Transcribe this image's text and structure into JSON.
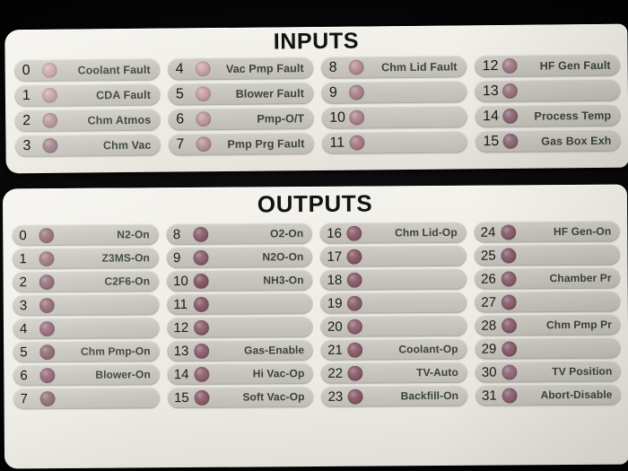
{
  "colors": {
    "background": "#000000",
    "panel": "#efeee8",
    "pill": "#c6c4bc",
    "label_text": "#3b4340",
    "number_text": "#1b1b1b",
    "title_text": "#141414",
    "led_inputs": "#c9a3a8",
    "led_outputs": "#8e5f6b"
  },
  "panels": [
    {
      "id": "inputs",
      "title": "INPUTS",
      "columns": [
        {
          "rows": [
            {
              "number": "0",
              "label": "Coolant Fault",
              "led": "#caa4a8"
            },
            {
              "number": "1",
              "label": "CDA Fault",
              "led": "#c49ca2"
            },
            {
              "number": "2",
              "label": "Chm Atmos",
              "led": "#b48f96"
            },
            {
              "number": "3",
              "label": "Chm Vac",
              "led": "#9c7c88"
            }
          ]
        },
        {
          "rows": [
            {
              "number": "4",
              "label": "Vac Pmp Fault",
              "led": "#cda5a7"
            },
            {
              "number": "5",
              "label": "Blower Fault",
              "led": "#c9a0a4"
            },
            {
              "number": "6",
              "label": "Pmp-O/T",
              "led": "#c09aa0"
            },
            {
              "number": "7",
              "label": "Pmp Prg Fault",
              "led": "#b8919a"
            }
          ]
        },
        {
          "rows": [
            {
              "number": "8",
              "label": "Chm Lid Fault",
              "led": "#b78f98"
            },
            {
              "number": "9",
              "label": "",
              "led": "#ab848f"
            },
            {
              "number": "10",
              "label": "",
              "led": "#b0848f"
            },
            {
              "number": "11",
              "label": "",
              "led": "#a87c89"
            }
          ]
        },
        {
          "rows": [
            {
              "number": "12",
              "label": "HF Gen Fault",
              "led": "#a57c8a"
            },
            {
              "number": "13",
              "label": "",
              "led": "#9c7682"
            },
            {
              "number": "14",
              "label": "Process Temp",
              "led": "#8f6a78"
            },
            {
              "number": "15",
              "label": "Gas Box Exh",
              "led": "#8d6b78"
            }
          ]
        }
      ]
    },
    {
      "id": "outputs",
      "title": "OUTPUTS",
      "columns": [
        {
          "rows": [
            {
              "number": "0",
              "label": "N2-On",
              "led": "#93646f"
            },
            {
              "number": "1",
              "label": "Z3MS-On",
              "led": "#9a6d78"
            },
            {
              "number": "2",
              "label": "C2F6-On",
              "led": "#8e6270"
            },
            {
              "number": "3",
              "label": "",
              "led": "#8d616e"
            },
            {
              "number": "4",
              "label": "",
              "led": "#8e6370"
            },
            {
              "number": "5",
              "label": "Chm Pmp-On",
              "led": "#8a5d6b"
            },
            {
              "number": "6",
              "label": "Blower-On",
              "led": "#8c5f6c"
            },
            {
              "number": "7",
              "label": "",
              "led": "#90646f"
            }
          ]
        },
        {
          "rows": [
            {
              "number": "8",
              "label": "O2-On",
              "led": "#8e616f"
            },
            {
              "number": "9",
              "label": "N2O-On",
              "led": "#8c6270"
            },
            {
              "number": "10",
              "label": "NH3-On",
              "led": "#87596a"
            },
            {
              "number": "11",
              "label": "",
              "led": "#8a5c6b"
            },
            {
              "number": "12",
              "label": "",
              "led": "#8e6070"
            },
            {
              "number": "13",
              "label": "Gas-Enable",
              "led": "#8d6070"
            },
            {
              "number": "14",
              "label": "Hi Vac-Op",
              "led": "#94636f"
            },
            {
              "number": "15",
              "label": "Soft Vac-Op",
              "led": "#8f5f6e"
            }
          ]
        },
        {
          "rows": [
            {
              "number": "16",
              "label": "Chm Lid-Op",
              "led": "#8e5d6c"
            },
            {
              "number": "17",
              "label": "",
              "led": "#8a5a6a"
            },
            {
              "number": "18",
              "label": "",
              "led": "#8d5e6d"
            },
            {
              "number": "19",
              "label": "",
              "led": "#8d5f6e"
            },
            {
              "number": "20",
              "label": "",
              "led": "#916472"
            },
            {
              "number": "21",
              "label": "Coolant-Op",
              "led": "#8c5d6d"
            },
            {
              "number": "22",
              "label": "TV-Auto",
              "led": "#8b5d6d"
            },
            {
              "number": "23",
              "label": "Backfill-On",
              "led": "#8a5c6c"
            }
          ]
        },
        {
          "rows": [
            {
              "number": "24",
              "label": "HF Gen-On",
              "led": "#8b5e6e"
            },
            {
              "number": "25",
              "label": "",
              "led": "#8a5d6e"
            },
            {
              "number": "26",
              "label": "Chamber Pr",
              "led": "#8e6171"
            },
            {
              "number": "27",
              "label": "",
              "led": "#8d6071"
            },
            {
              "number": "28",
              "label": "Chm Pmp Pr",
              "led": "#8d6072"
            },
            {
              "number": "29",
              "label": "",
              "led": "#8b5e70"
            },
            {
              "number": "30",
              "label": "TV Position",
              "led": "#956b7d"
            },
            {
              "number": "31",
              "label": "Abort-Disable",
              "led": "#8f6275"
            }
          ]
        }
      ]
    }
  ]
}
